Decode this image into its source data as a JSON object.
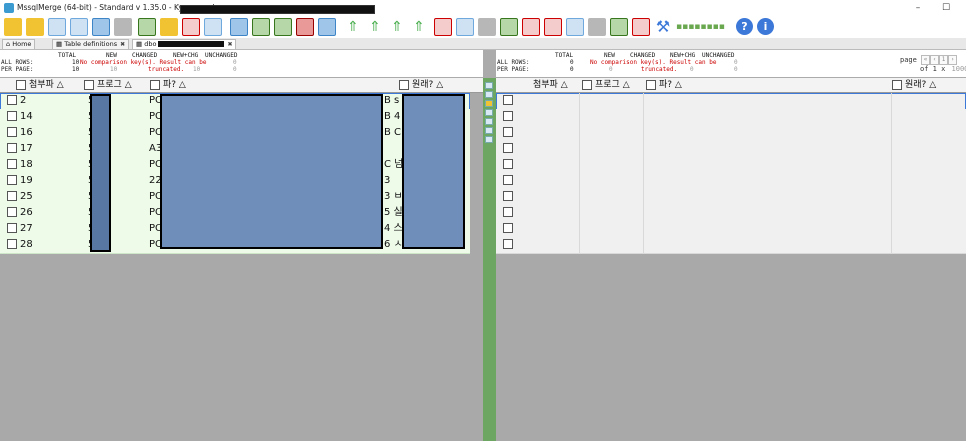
{
  "window": {
    "title": "MssqlMerge (64-bit) - Standard v 1.35.0 - Kyungsoo Jung -",
    "min_label": "–",
    "max_label": "☐"
  },
  "tabs": [
    {
      "label": "Home",
      "closable": false
    },
    {
      "label": "Table definitions",
      "closable": true
    },
    {
      "label": "dbo",
      "closable": true
    }
  ],
  "left_summary": {
    "all_rows_label": "ALL ROWS:",
    "per_page_label": "PER PAGE:",
    "total_header": "TOTAL",
    "new_header": "NEW",
    "changed_header": "CHANGED",
    "newchg_header": "NEW+CHG",
    "unchanged_header": "UNCHANGED",
    "total_all": "10",
    "total_page": "10",
    "warning_line1": "No comparison key(s). Result can be",
    "warning_line2": "truncated.",
    "muted_all": "0",
    "muted_page_a": "10",
    "muted_page_b": "10",
    "muted_page_c": "0"
  },
  "right_summary": {
    "all_rows_label": "ALL ROWS:",
    "per_page_label": "PER PAGE:",
    "total_header": "TOTAL",
    "new_header": "NEW",
    "changed_header": "CHANGED",
    "newchg_header": "NEW+CHG",
    "unchanged_header": "UNCHANGED",
    "total_all": "0",
    "total_page": "0",
    "warning_line1": "No comparison key(s). Result can be",
    "warning_line2": "truncated.",
    "muted_all": "0",
    "muted_page_a": "0",
    "muted_page_b": "0",
    "muted_page_c": "0"
  },
  "pager": {
    "page_label": "page",
    "page_value": "1",
    "of_label": "of 1 x",
    "page_size": "10000"
  },
  "left_grid": {
    "columns": [
      "첨부파 △",
      "프로그 △",
      "파? △",
      "원래? △"
    ],
    "rows": [
      {
        "id": "2",
        "c1": "5",
        "c2": "PO",
        "c3": "B s"
      },
      {
        "id": "14",
        "c1": "5",
        "c2": "PO",
        "c3": "B 4"
      },
      {
        "id": "16",
        "c1": "5",
        "c2": "PO",
        "c3": "B C"
      },
      {
        "id": "17",
        "c1": "5",
        "c2": "A3",
        "c3": ""
      },
      {
        "id": "18",
        "c1": "5",
        "c2": "PO",
        "c3": "C 넘"
      },
      {
        "id": "19",
        "c1": "5",
        "c2": "22",
        "c3": "3"
      },
      {
        "id": "25",
        "c1": "5",
        "c2": "PO",
        "c3": "3 ㅂ"
      },
      {
        "id": "26",
        "c1": "5",
        "c2": "PO",
        "c3": "5 실"
      },
      {
        "id": "27",
        "c1": "5",
        "c2": "PO",
        "c3": "4 스"
      },
      {
        "id": "28",
        "c1": "5",
        "c2": "PO",
        "c3": "6 ㅅ"
      }
    ]
  },
  "right_grid": {
    "columns": [
      "첨부파 △",
      "프로그 △",
      "파? △",
      "원래? △"
    ],
    "row_count": 10
  },
  "colors": {
    "left_row_bg": "#eefbe9",
    "splitter": "#6ca662",
    "selected_border": "#3c78d8"
  }
}
